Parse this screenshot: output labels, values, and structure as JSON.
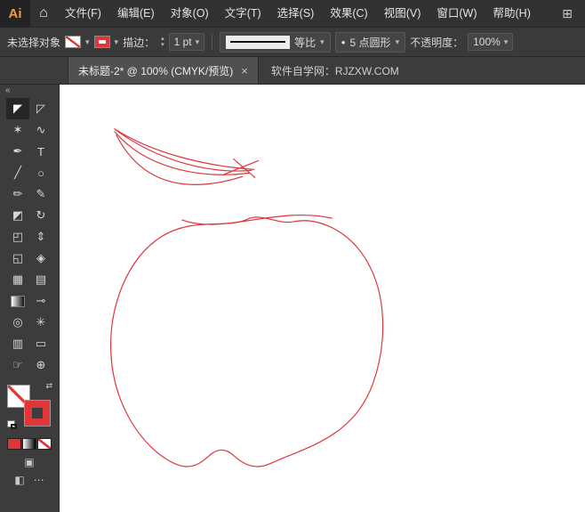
{
  "colors": {
    "accent_red": "#e0363a",
    "logo_orange": "#f49b42"
  },
  "titlebar": {
    "logo": "Ai"
  },
  "menubar": {
    "items": [
      "文件(F)",
      "编辑(E)",
      "对象(O)",
      "文字(T)",
      "选择(S)",
      "效果(C)",
      "视图(V)",
      "窗口(W)",
      "帮助(H)"
    ]
  },
  "controlbar": {
    "status": "未选择对象",
    "stroke_label": "描边：",
    "stroke_value": "1 pt",
    "profile_label": "等比",
    "brush_label": "5 点圆形",
    "opacity_label": "不透明度：",
    "opacity_value": "100%"
  },
  "tabbar": {
    "tab_title": "未标题-2* @ 100% (CMYK/预览)",
    "site_text": "软件自学网：RJZXW.COM"
  },
  "icons": {
    "home": "⌂",
    "workspace": "⊞",
    "caret": "▾",
    "step_up": "▴",
    "step_down": "▾",
    "close": "×",
    "collapse": "«",
    "swap": "⇄",
    "brush_dot": "●",
    "draw_mode": "▣",
    "screen_mode": "◧",
    "more": "⋯"
  },
  "toolbar": {
    "tools": [
      {
        "name": "selection",
        "glyph": "◤"
      },
      {
        "name": "direct-selection",
        "glyph": "◸"
      },
      {
        "name": "magic-wand",
        "glyph": "✶"
      },
      {
        "name": "lasso",
        "glyph": "∿"
      },
      {
        "name": "pen",
        "glyph": "✒"
      },
      {
        "name": "type",
        "glyph": "T"
      },
      {
        "name": "line-segment",
        "glyph": "╱"
      },
      {
        "name": "ellipse",
        "glyph": "○"
      },
      {
        "name": "paintbrush",
        "glyph": "✏"
      },
      {
        "name": "pencil",
        "glyph": "✎"
      },
      {
        "name": "eraser",
        "glyph": "◩"
      },
      {
        "name": "rotate",
        "glyph": "↻"
      },
      {
        "name": "scale",
        "glyph": "◰"
      },
      {
        "name": "width",
        "glyph": "⇕"
      },
      {
        "name": "free-transform",
        "glyph": "◱"
      },
      {
        "name": "shape-builder",
        "glyph": "◈"
      },
      {
        "name": "perspective-grid",
        "glyph": "▦"
      },
      {
        "name": "mesh",
        "glyph": "▤"
      },
      {
        "name": "gradient",
        "glyph": ""
      },
      {
        "name": "eyedropper",
        "glyph": "⊸"
      },
      {
        "name": "blend",
        "glyph": "◎"
      },
      {
        "name": "symbol-sprayer",
        "glyph": "✳"
      },
      {
        "name": "column-graph",
        "glyph": "▥"
      },
      {
        "name": "artboard",
        "glyph": "▭"
      },
      {
        "name": "hand",
        "glyph": "☞"
      },
      {
        "name": "zoom",
        "glyph": "⊕"
      }
    ]
  },
  "canvas": {
    "stroke_color": "#e0363a",
    "paths": [
      "M 214,151 C 192,164 152,149 116,171 C 76,196 55,251 58,305 C 61,362 93,411 129,428 C 148,437 159,428 169,419 C 178,411 187,411 196,419 C 206,428 219,437 238,428 C 277,410 331,399 353,338 C 369,293 369,238 346,199 C 326,165 291,149 263,155 C 246,158 229,146 214,151",
      "M 138,153 C 185,170 245,137 307,151",
      "M 62,50 C 104,77 163,92 219,96",
      "M 63,51 C 112,87 170,101 216,97",
      "M 62,53 C 96,94 157,107 214,100",
      "M 64,57 C 92,112 142,124 206,104",
      "M 184,102 L 224,86",
      "M 196,84 L 220,105"
    ]
  }
}
